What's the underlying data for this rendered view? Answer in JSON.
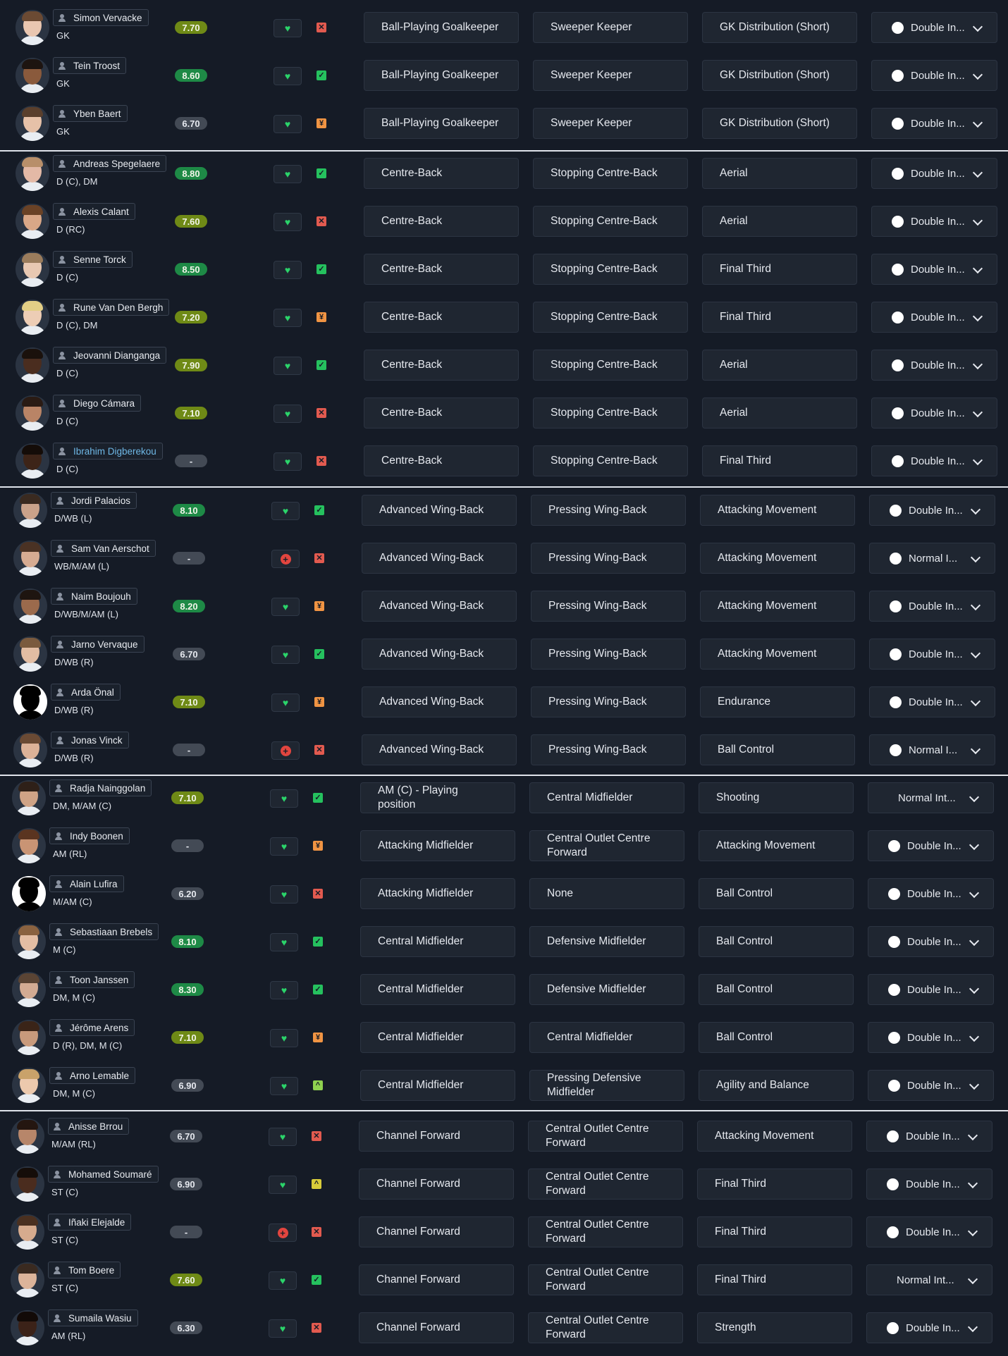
{
  "players": [
    {
      "name": "Simon Vervacke",
      "pos": "GK",
      "rating": "7.70",
      "rating_tier": "mid",
      "fitness": "heart",
      "status": "x",
      "role": "Ball-Playing Goalkeeper",
      "alt_role": "Sweeper Keeper",
      "focus": "GK Distribution (Short)",
      "intensity": "Double In...",
      "intensity_dot": true,
      "avatar": {
        "skin": "#e9c6b0",
        "hair": "#6b4a33"
      }
    },
    {
      "name": "Tein Troost",
      "pos": "GK",
      "rating": "8.60",
      "rating_tier": "hi",
      "fitness": "heart",
      "status": "ok",
      "role": "Ball-Playing Goalkeeper",
      "alt_role": "Sweeper Keeper",
      "focus": "GK Distribution (Short)",
      "intensity": "Double In...",
      "intensity_dot": true,
      "avatar": {
        "skin": "#8a5a3c",
        "hair": "#1d1410"
      }
    },
    {
      "name": "Yben Baert",
      "pos": "GK",
      "rating": "6.70",
      "rating_tier": "lo",
      "fitness": "heart",
      "status": "o",
      "role": "Ball-Playing Goalkeeper",
      "alt_role": "Sweeper Keeper",
      "focus": "GK Distribution (Short)",
      "intensity": "Double In...",
      "intensity_dot": true,
      "avatar": {
        "skin": "#e6c1a8",
        "hair": "#5a3f2c"
      }
    },
    {
      "name": "Andreas Spegelaere",
      "pos": "D (C), DM",
      "rating": "8.80",
      "rating_tier": "hi",
      "fitness": "heart",
      "status": "ok",
      "role": "Centre-Back",
      "alt_role": "Stopping Centre-Back",
      "focus": "Aerial",
      "intensity": "Double In...",
      "intensity_dot": true,
      "avatar": {
        "skin": "#e3b9a6",
        "hair": "#b88f6a"
      }
    },
    {
      "name": "Alexis Calant",
      "pos": "D (RC)",
      "rating": "7.60",
      "rating_tier": "mid",
      "fitness": "heart",
      "status": "x",
      "role": "Centre-Back",
      "alt_role": "Stopping Centre-Back",
      "focus": "Aerial",
      "intensity": "Double In...",
      "intensity_dot": true,
      "avatar": {
        "skin": "#d9a787",
        "hair": "#6a4226"
      }
    },
    {
      "name": "Senne Torck",
      "pos": "D (C)",
      "rating": "8.50",
      "rating_tier": "hi",
      "fitness": "heart",
      "status": "ok",
      "role": "Centre-Back",
      "alt_role": "Stopping Centre-Back",
      "focus": "Final Third",
      "intensity": "Double In...",
      "intensity_dot": true,
      "avatar": {
        "skin": "#e8c8b2",
        "hair": "#9a7c5c"
      }
    },
    {
      "name": "Rune Van Den Bergh",
      "pos": "D (C), DM",
      "rating": "7.20",
      "rating_tier": "mid",
      "fitness": "heart",
      "status": "o",
      "role": "Centre-Back",
      "alt_role": "Stopping Centre-Back",
      "focus": "Final Third",
      "intensity": "Double In...",
      "intensity_dot": true,
      "avatar": {
        "skin": "#edcdb5",
        "hair": "#e3cf86"
      }
    },
    {
      "name": "Jeovanni Dianganga",
      "pos": "D (C)",
      "rating": "7.90",
      "rating_tier": "mid",
      "fitness": "heart",
      "status": "ok",
      "role": "Centre-Back",
      "alt_role": "Stopping Centre-Back",
      "focus": "Aerial",
      "intensity": "Double In...",
      "intensity_dot": true,
      "avatar": {
        "skin": "#4a2d1f",
        "hair": "#1a110c"
      }
    },
    {
      "name": "Diego Cámara",
      "pos": "D (C)",
      "rating": "7.10",
      "rating_tier": "mid",
      "fitness": "heart",
      "status": "x",
      "role": "Centre-Back",
      "alt_role": "Stopping Centre-Back",
      "focus": "Aerial",
      "intensity": "Double In...",
      "intensity_dot": true,
      "avatar": {
        "skin": "#b98466",
        "hair": "#2a1b14"
      }
    },
    {
      "name": "Ibrahim Digberekou",
      "pos": "D (C)",
      "rating": "-",
      "rating_tier": "none",
      "fitness": "heart",
      "status": "x",
      "role": "Centre-Back",
      "alt_role": "Stopping Centre-Back",
      "focus": "Final Third",
      "intensity": "Double In...",
      "intensity_dot": true,
      "link": true,
      "avatar": {
        "skin": "#3d2418",
        "hair": "#140c08"
      }
    },
    {
      "name": "Jordi Palacios",
      "pos": "D/WB (L)",
      "rating": "8.10",
      "rating_tier": "hi",
      "fitness": "heart",
      "status": "ok",
      "role": "Advanced Wing-Back",
      "alt_role": "Pressing Wing-Back",
      "focus": "Attacking Movement",
      "intensity": "Double In...",
      "intensity_dot": true,
      "avatar": {
        "skin": "#caa28a",
        "hair": "#3a2a20"
      }
    },
    {
      "name": "Sam Van Aerschot",
      "pos": "WB/M/AM (L)",
      "rating": "-",
      "rating_tier": "none",
      "fitness": "plus",
      "status": "x",
      "role": "Advanced Wing-Back",
      "alt_role": "Pressing Wing-Back",
      "focus": "Attacking Movement",
      "intensity": "Normal I...",
      "intensity_dot": true,
      "avatar": {
        "skin": "#d6ab92",
        "hair": "#4a3224"
      }
    },
    {
      "name": "Naim Boujouh",
      "pos": "D/WB/M/AM (L)",
      "rating": "8.20",
      "rating_tier": "hi",
      "fitness": "heart",
      "status": "o",
      "role": "Advanced Wing-Back",
      "alt_role": "Pressing Wing-Back",
      "focus": "Attacking Movement",
      "intensity": "Double In...",
      "intensity_dot": true,
      "avatar": {
        "skin": "#9b6a4c",
        "hair": "#1e1510"
      }
    },
    {
      "name": "Jarno Vervaque",
      "pos": "D/WB (R)",
      "rating": "6.70",
      "rating_tier": "lo",
      "fitness": "heart",
      "status": "ok",
      "role": "Advanced Wing-Back",
      "alt_role": "Pressing Wing-Back",
      "focus": "Attacking Movement",
      "intensity": "Double In...",
      "intensity_dot": true,
      "avatar": {
        "skin": "#e2bda3",
        "hair": "#7a5a3e"
      }
    },
    {
      "name": "Arda Önal",
      "pos": "D/WB (R)",
      "rating": "7.10",
      "rating_tier": "mid",
      "fitness": "heart",
      "status": "o",
      "role": "Advanced Wing-Back",
      "alt_role": "Pressing Wing-Back",
      "focus": "Endurance",
      "intensity": "Double In...",
      "intensity_dot": true,
      "silhouette": true,
      "avatar": {
        "skin": "#000000",
        "hair": "#000000"
      }
    },
    {
      "name": "Jonas Vinck",
      "pos": "D/WB (R)",
      "rating": "-",
      "rating_tier": "none",
      "fitness": "plus",
      "status": "x",
      "role": "Advanced Wing-Back",
      "alt_role": "Pressing Wing-Back",
      "focus": "Ball Control",
      "intensity": "Normal I...",
      "intensity_dot": true,
      "avatar": {
        "skin": "#dcb298",
        "hair": "#6a4a34"
      }
    },
    {
      "name": "Radja Nainggolan",
      "pos": "DM, M/AM (C)",
      "rating": "7.10",
      "rating_tier": "mid",
      "fitness": "heart",
      "status": "ok",
      "role": "AM (C) - Playing position",
      "alt_role": "Central Midfielder",
      "focus": "Shooting",
      "intensity": "Normal Int...",
      "intensity_dot": false,
      "avatar": {
        "skin": "#cfa386",
        "hair": "#2e2018"
      }
    },
    {
      "name": "Indy Boonen",
      "pos": "AM (RL)",
      "rating": "-",
      "rating_tier": "none",
      "fitness": "heart",
      "status": "o",
      "role": "Attacking Midfielder",
      "alt_role": "Central Outlet Centre Forward",
      "focus": "Attacking Movement",
      "intensity": "Double In...",
      "intensity_dot": true,
      "avatar": {
        "skin": "#c99474",
        "hair": "#5a3420"
      }
    },
    {
      "name": "Alain Lufira",
      "pos": "M/AM (C)",
      "rating": "6.20",
      "rating_tier": "lo",
      "fitness": "heart",
      "status": "x",
      "role": "Attacking Midfielder",
      "alt_role": "None",
      "focus": "Ball Control",
      "intensity": "Double In...",
      "intensity_dot": true,
      "silhouette": true,
      "avatar": {
        "skin": "#000000",
        "hair": "#000000"
      }
    },
    {
      "name": "Sebastiaan Brebels",
      "pos": "M (C)",
      "rating": "8.10",
      "rating_tier": "hi",
      "fitness": "heart",
      "status": "ok",
      "role": "Central Midfielder",
      "alt_role": "Defensive Midfielder",
      "focus": "Ball Control",
      "intensity": "Double In...",
      "intensity_dot": true,
      "avatar": {
        "skin": "#e4bea4",
        "hair": "#8a6240"
      }
    },
    {
      "name": "Toon Janssen",
      "pos": "DM, M (C)",
      "rating": "8.30",
      "rating_tier": "hi",
      "fitness": "heart",
      "status": "ok",
      "role": "Central Midfielder",
      "alt_role": "Defensive Midfielder",
      "focus": "Ball Control",
      "intensity": "Double In...",
      "intensity_dot": true,
      "avatar": {
        "skin": "#d3ab93",
        "hair": "#5a4434"
      }
    },
    {
      "name": "Jérôme Arens",
      "pos": "D (R), DM, M (C)",
      "rating": "7.10",
      "rating_tier": "mid",
      "fitness": "heart",
      "status": "o",
      "role": "Central Midfielder",
      "alt_role": "Central Midfielder",
      "focus": "Ball Control",
      "intensity": "Double In...",
      "intensity_dot": true,
      "avatar": {
        "skin": "#c89a7c",
        "hair": "#3a2418"
      }
    },
    {
      "name": "Arno Lemable",
      "pos": "DM, M (C)",
      "rating": "6.90",
      "rating_tier": "lo",
      "fitness": "heart",
      "status": "l",
      "role": "Central Midfielder",
      "alt_role": "Pressing Defensive Midfielder",
      "focus": "Agility and Balance",
      "intensity": "Double In...",
      "intensity_dot": true,
      "avatar": {
        "skin": "#ecc9ad",
        "hair": "#c9a26a"
      }
    },
    {
      "name": "Anisse Brrou",
      "pos": "M/AM (RL)",
      "rating": "6.70",
      "rating_tier": "lo",
      "fitness": "heart",
      "status": "x",
      "role": "Channel Forward",
      "alt_role": "Central Outlet Centre Forward",
      "focus": "Attacking Movement",
      "intensity": "Double In...",
      "intensity_dot": true,
      "avatar": {
        "skin": "#b7866a",
        "hair": "#241610"
      }
    },
    {
      "name": "Mohamed Soumaré",
      "pos": "ST (C)",
      "rating": "6.90",
      "rating_tier": "lo",
      "fitness": "heart",
      "status": "y",
      "role": "Channel Forward",
      "alt_role": "Central Outlet Centre Forward",
      "focus": "Final Third",
      "intensity": "Double In...",
      "intensity_dot": true,
      "avatar": {
        "skin": "#4a2c1e",
        "hair": "#150d09"
      }
    },
    {
      "name": "Iñaki Elejalde",
      "pos": "ST (C)",
      "rating": "-",
      "rating_tier": "none",
      "fitness": "plus",
      "status": "x",
      "role": "Channel Forward",
      "alt_role": "Central Outlet Centre Forward",
      "focus": "Final Third",
      "intensity": "Double In...",
      "intensity_dot": true,
      "avatar": {
        "skin": "#d6ab8e",
        "hair": "#4a3020"
      }
    },
    {
      "name": "Tom Boere",
      "pos": "ST (C)",
      "rating": "7.60",
      "rating_tier": "mid",
      "fitness": "heart",
      "status": "ok",
      "role": "Channel Forward",
      "alt_role": "Central Outlet Centre Forward",
      "focus": "Final Third",
      "intensity": "Normal Int...",
      "intensity_dot": false,
      "avatar": {
        "skin": "#dcb49a",
        "hair": "#3a2a20"
      }
    },
    {
      "name": "Sumaila Wasiu",
      "pos": "AM (RL)",
      "rating": "6.30",
      "rating_tier": "lo",
      "fitness": "heart",
      "status": "x",
      "role": "Channel Forward",
      "alt_role": "Central Outlet Centre Forward",
      "focus": "Strength",
      "intensity": "Double In...",
      "intensity_dot": true,
      "avatar": {
        "skin": "#3b2218",
        "hair": "#120a07"
      }
    }
  ],
  "status_glyphs": {
    "ok": "✓",
    "x": "✕",
    "o": "¥",
    "y": "^",
    "l": "^"
  },
  "colors": {
    "background": "#151b26",
    "rating_high": "#1e8a46",
    "rating_mid": "#6f8a16",
    "rating_low": "#434a55",
    "heart": "#2bd46a",
    "status_ok": "#25c15e",
    "status_bad": "#e25a4f",
    "status_warn": "#f09443"
  }
}
